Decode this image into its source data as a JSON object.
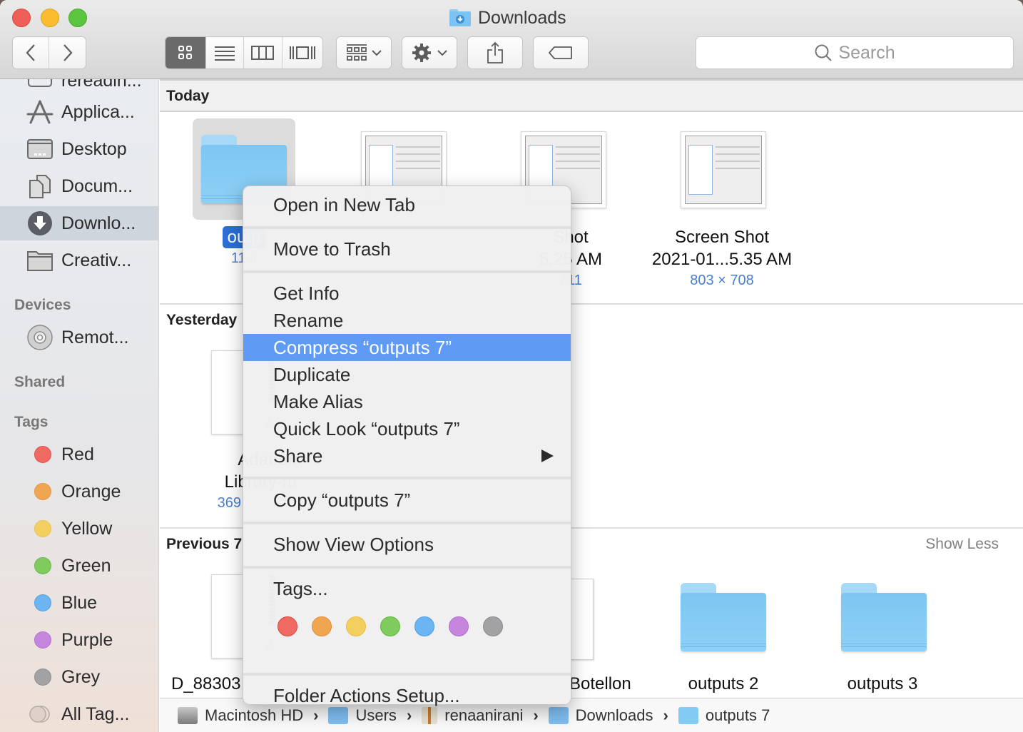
{
  "window": {
    "title": "Downloads",
    "traffic_lights": [
      "close",
      "minimize",
      "zoom"
    ]
  },
  "toolbar": {
    "back_icon": "chevron-left-icon",
    "forward_icon": "chevron-right-icon",
    "view_modes": [
      {
        "name": "icon-view",
        "icon": "grid-icon",
        "active": true
      },
      {
        "name": "list-view",
        "icon": "list-icon",
        "active": false
      },
      {
        "name": "column-view",
        "icon": "columns-icon",
        "active": false
      },
      {
        "name": "gallery-view",
        "icon": "gallery-icon",
        "active": false
      }
    ],
    "group_icon": "group-by-icon",
    "action_icon": "gear-icon",
    "share_icon": "share-icon",
    "tag_icon": "tag-icon",
    "search_placeholder": "Search"
  },
  "sidebar": {
    "favorites": [
      {
        "label": "rereadin...",
        "icon": "drive-icon",
        "selected": false
      },
      {
        "label": "Applica...",
        "icon": "applications-icon",
        "selected": false
      },
      {
        "label": "Desktop",
        "icon": "desktop-icon",
        "selected": false
      },
      {
        "label": "Docum...",
        "icon": "documents-icon",
        "selected": false
      },
      {
        "label": "Downlo...",
        "icon": "downloads-icon",
        "selected": true
      },
      {
        "label": "Creativ...",
        "icon": "folder-icon",
        "selected": false
      }
    ],
    "devices_header": "Devices",
    "devices": [
      {
        "label": "Remot...",
        "icon": "disc-icon"
      }
    ],
    "shared_header": "Shared",
    "tags_header": "Tags",
    "tags": [
      {
        "label": "Red",
        "color": "#ee6a62"
      },
      {
        "label": "Orange",
        "color": "#f0a552"
      },
      {
        "label": "Yellow",
        "color": "#f3cf5f"
      },
      {
        "label": "Green",
        "color": "#7fcb5e"
      },
      {
        "label": "Blue",
        "color": "#6cb4f2"
      },
      {
        "label": "Purple",
        "color": "#c686de"
      },
      {
        "label": "Grey",
        "color": "#a2a2a4"
      },
      {
        "label": "All Tag...",
        "color": "#d8cdc6"
      }
    ]
  },
  "content": {
    "groups": [
      {
        "title": "Today",
        "items": [
          {
            "name": "outp",
            "meta": "11 it",
            "kind": "folder",
            "selected": true
          },
          {
            "name_lines": [
              "",
              ""
            ],
            "meta": "",
            "kind": "screenshot"
          },
          {
            "name_lines": [
              "Shot",
              "5.25 AM"
            ],
            "meta": "711",
            "kind": "screenshot"
          },
          {
            "name_lines": [
              "Screen Shot",
              "2021-01...5.35 AM"
            ],
            "meta": "803 × 708",
            "kind": "screenshot"
          }
        ]
      },
      {
        "title": "Yesterday",
        "items": [
          {
            "name_lines": [
              "Adafruit",
              "Library-m"
            ],
            "meta": "369",
            "kind": "zip"
          }
        ]
      },
      {
        "title": "Previous 7",
        "show_less": "Show Less",
        "items": [
          {
            "name": "D_88303",
            "kind": "zip"
          },
          {
            "name": "Botellon",
            "kind": "document"
          },
          {
            "name": "outputs 2",
            "kind": "folder"
          },
          {
            "name": "outputs 3",
            "kind": "folder"
          }
        ]
      }
    ]
  },
  "pathbar": [
    {
      "label": "Macintosh HD",
      "icon": "hard-drive-icon"
    },
    {
      "label": "Users",
      "icon": "users-folder-icon"
    },
    {
      "label": "renaanirani",
      "icon": "home-icon"
    },
    {
      "label": "Downloads",
      "icon": "downloads-folder-icon"
    },
    {
      "label": "outputs 7",
      "icon": "folder-icon"
    }
  ],
  "context_menu": {
    "items": [
      {
        "label": "Open in New Tab"
      },
      {
        "label": "Move to Trash"
      },
      {
        "label": "Get Info"
      },
      {
        "label": "Rename"
      },
      {
        "label": "Compress “outputs 7”",
        "highlighted": true
      },
      {
        "label": "Duplicate"
      },
      {
        "label": "Make Alias"
      },
      {
        "label": "Quick Look “outputs 7”"
      },
      {
        "label": "Share",
        "submenu": true
      },
      {
        "label": "Copy “outputs 7”"
      },
      {
        "label": "Show View Options"
      },
      {
        "label": "Tags..."
      },
      {
        "label": "Folder Actions Setup..."
      }
    ],
    "tag_colors": [
      {
        "name": "red",
        "color": "#ee6a62"
      },
      {
        "name": "orange",
        "color": "#f0a552"
      },
      {
        "name": "yellow",
        "color": "#f3cf5f"
      },
      {
        "name": "green",
        "color": "#7fcb5e"
      },
      {
        "name": "blue",
        "color": "#6cb4f2"
      },
      {
        "name": "purple",
        "color": "#c686de"
      },
      {
        "name": "grey",
        "color": "#a2a2a4"
      }
    ]
  },
  "colors": {
    "accent": "#2c6fd6",
    "menu_highlight": "#5f9bf5",
    "meta_text": "#4a7fcf",
    "folder_blue": "#84cbf4"
  }
}
